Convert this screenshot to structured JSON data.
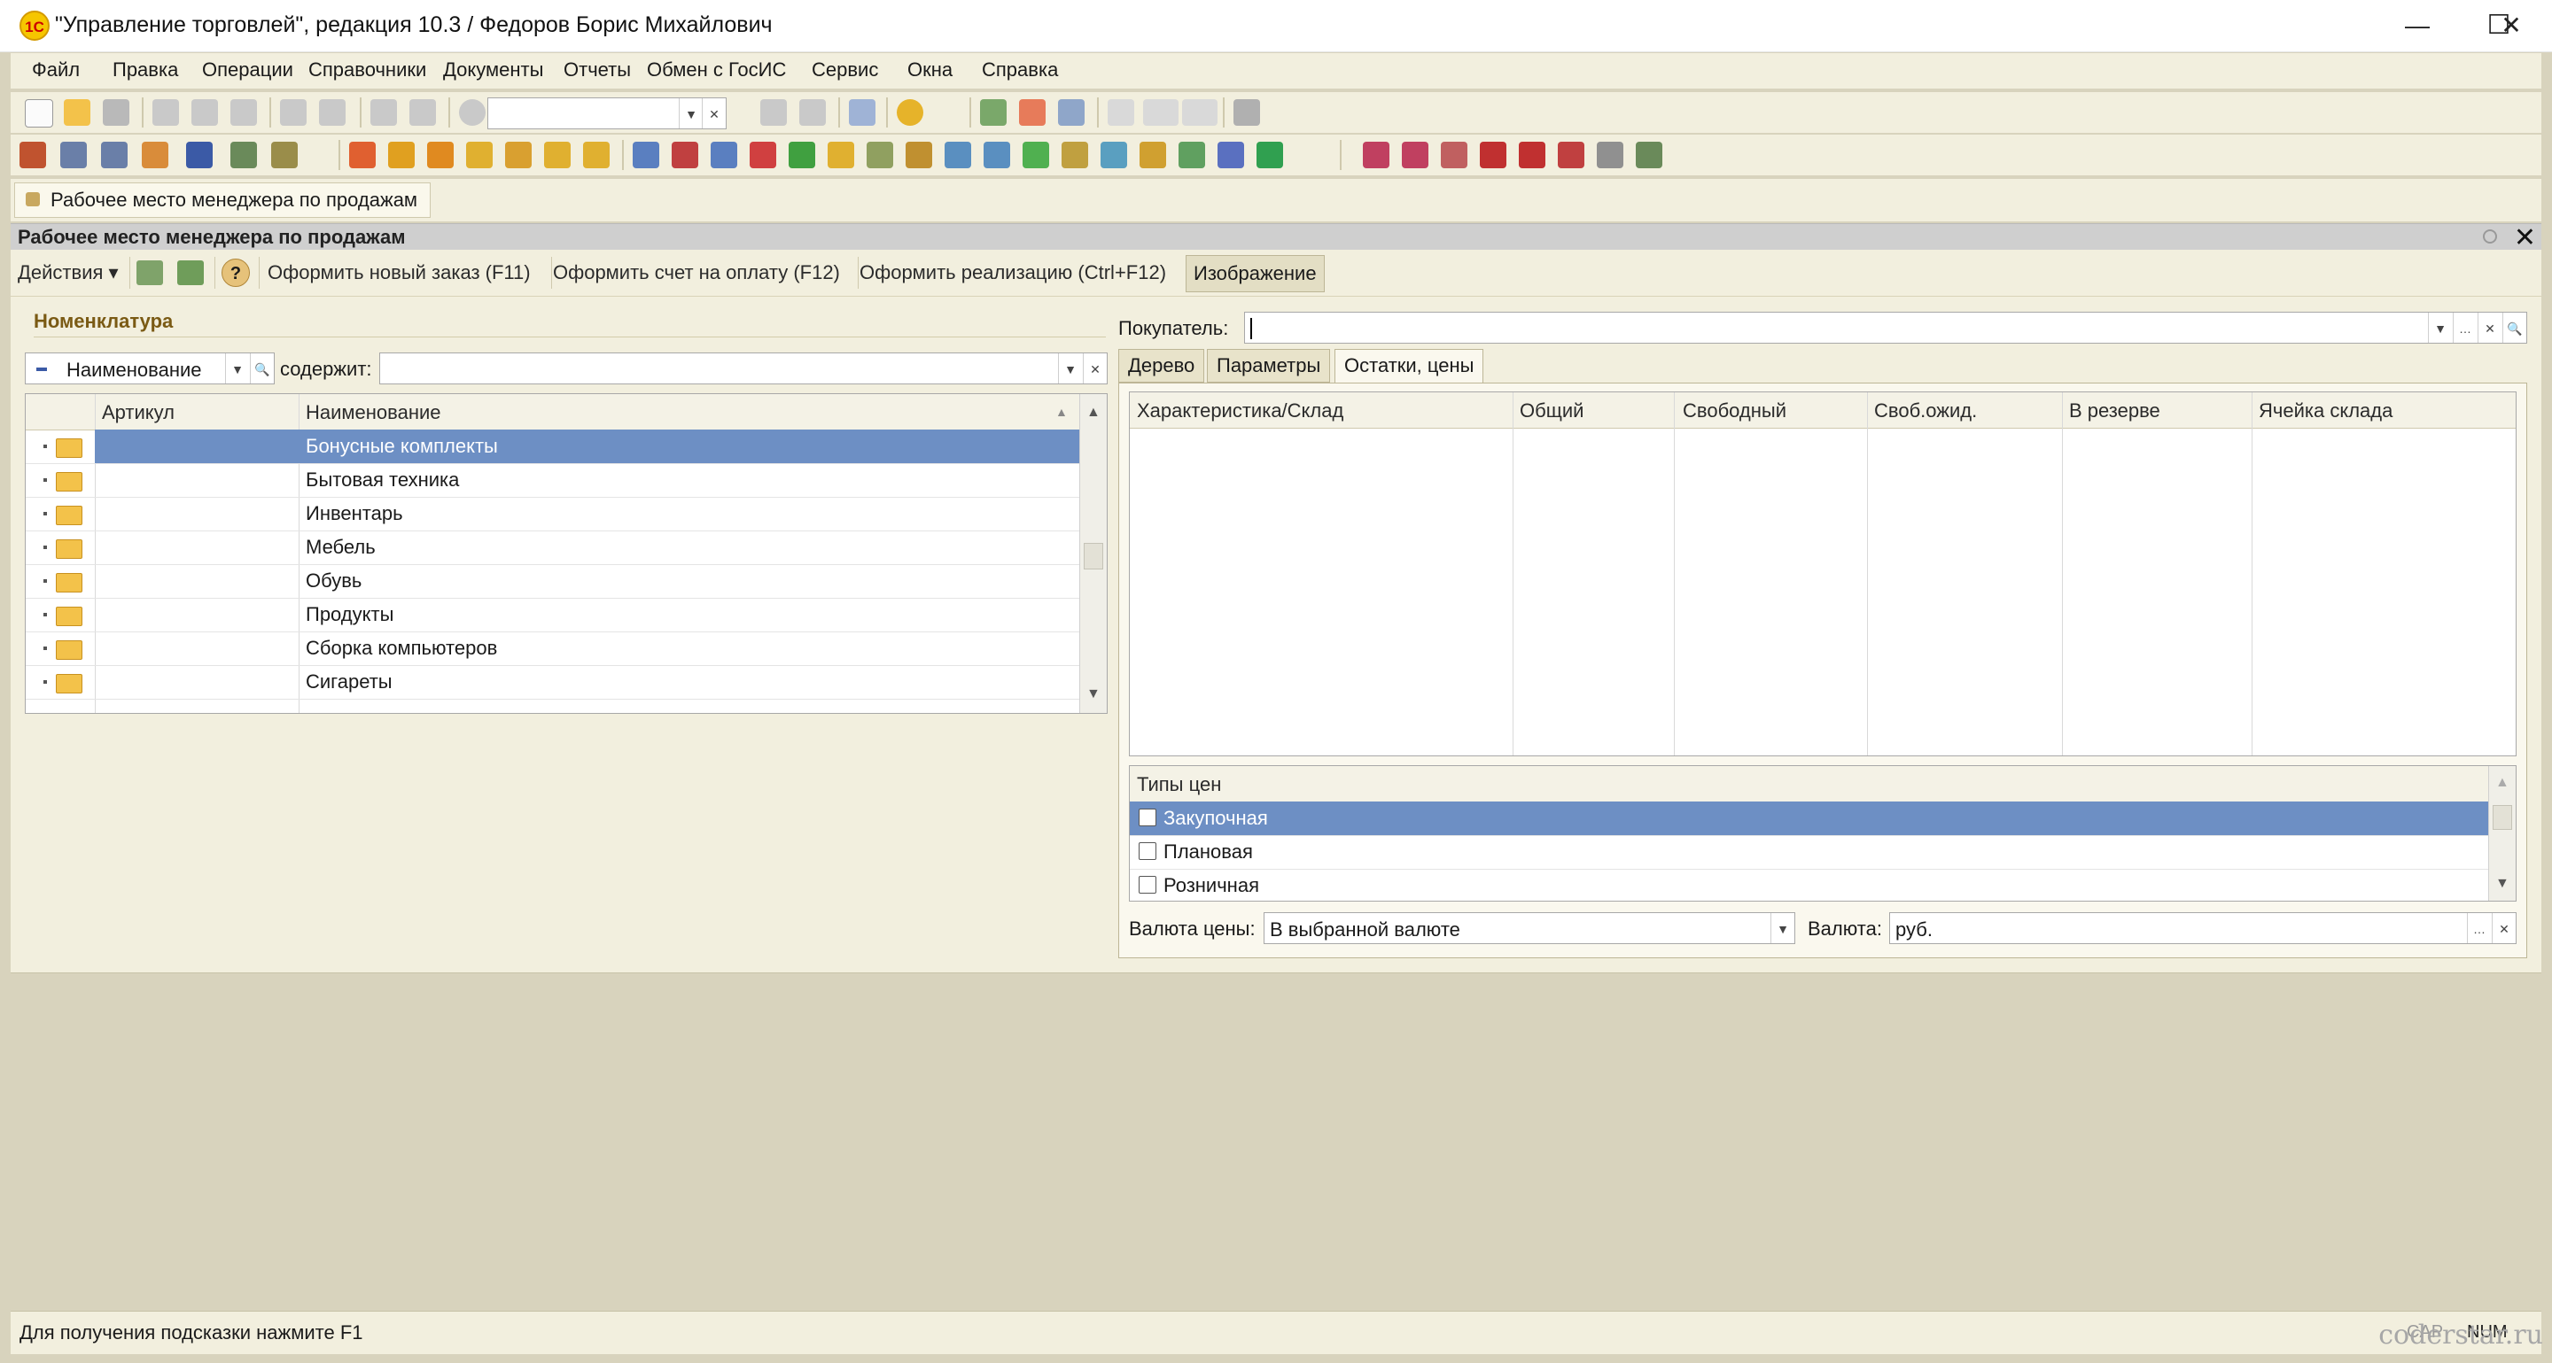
{
  "window": {
    "title": "\"Управление торговлей\", редакция 10.3 / Федоров Борис Михайлович",
    "logo": "1С",
    "controls": [
      "—",
      "☐",
      "✕"
    ]
  },
  "menu": [
    "Файл",
    "Правка",
    "Операции",
    "Справочники",
    "Документы",
    "Отчеты",
    "Обмен с ГосИС",
    "Сервис",
    "Окна",
    "Справка"
  ],
  "open_tab": "Рабочее место менеджера по продажам",
  "form": {
    "title": "Рабочее место менеджера по продажам",
    "actions": {
      "menu": "Действия",
      "help": "?",
      "new_order": "Оформить новый заказ (F11)",
      "invoice": "Оформить счет на оплату (F12)",
      "sale": "Оформить реализацию (Ctrl+F12)",
      "image": "Изображение"
    }
  },
  "nomenclature": {
    "section_title": "Номенклатура",
    "filter_field": "Наименование",
    "contains_label": "содержит:",
    "contains_value": "",
    "columns": [
      "Артикул",
      "Наименование"
    ],
    "rows": [
      {
        "article": "",
        "name": "Бонусные комплекты",
        "selected": true
      },
      {
        "article": "",
        "name": "Бытовая техника",
        "selected": false
      },
      {
        "article": "",
        "name": "Инвентарь",
        "selected": false
      },
      {
        "article": "",
        "name": "Мебель",
        "selected": false
      },
      {
        "article": "",
        "name": "Обувь",
        "selected": false
      },
      {
        "article": "",
        "name": "Продукты",
        "selected": false
      },
      {
        "article": "",
        "name": "Сборка компьютеров",
        "selected": false
      },
      {
        "article": "",
        "name": "Сигареты",
        "selected": false
      }
    ]
  },
  "buyer": {
    "label": "Покупатель:",
    "value": ""
  },
  "tabs": [
    {
      "label": "Дерево",
      "active": false
    },
    {
      "label": "Параметры",
      "active": false
    },
    {
      "label": "Остатки, цены",
      "active": true
    }
  ],
  "stock_grid": {
    "columns": [
      "Характеристика/Склад",
      "Общий",
      "Свободный",
      "Своб.ожид.",
      "В резерве",
      "Ячейка склада"
    ]
  },
  "price_types": {
    "header": "Типы цен",
    "items": [
      {
        "label": "Закупочная",
        "checked": false,
        "selected": true
      },
      {
        "label": "Плановая",
        "checked": false,
        "selected": false
      },
      {
        "label": "Розничная",
        "checked": false,
        "selected": false
      }
    ]
  },
  "currency": {
    "price_currency_label": "Валюта цены:",
    "price_currency_value": "В выбранной валюте",
    "currency_label": "Валюта:",
    "currency_value": "руб."
  },
  "status": {
    "hint": "Для получения подсказки нажмите F1",
    "cap": "CAP",
    "num": "NUM"
  },
  "watermark": "coderstar.ru",
  "colors": {
    "selection": "#6d8fc4",
    "panel": "#f2efde",
    "desktop": "#d8d3bd",
    "section_title": "#7a5a14"
  }
}
